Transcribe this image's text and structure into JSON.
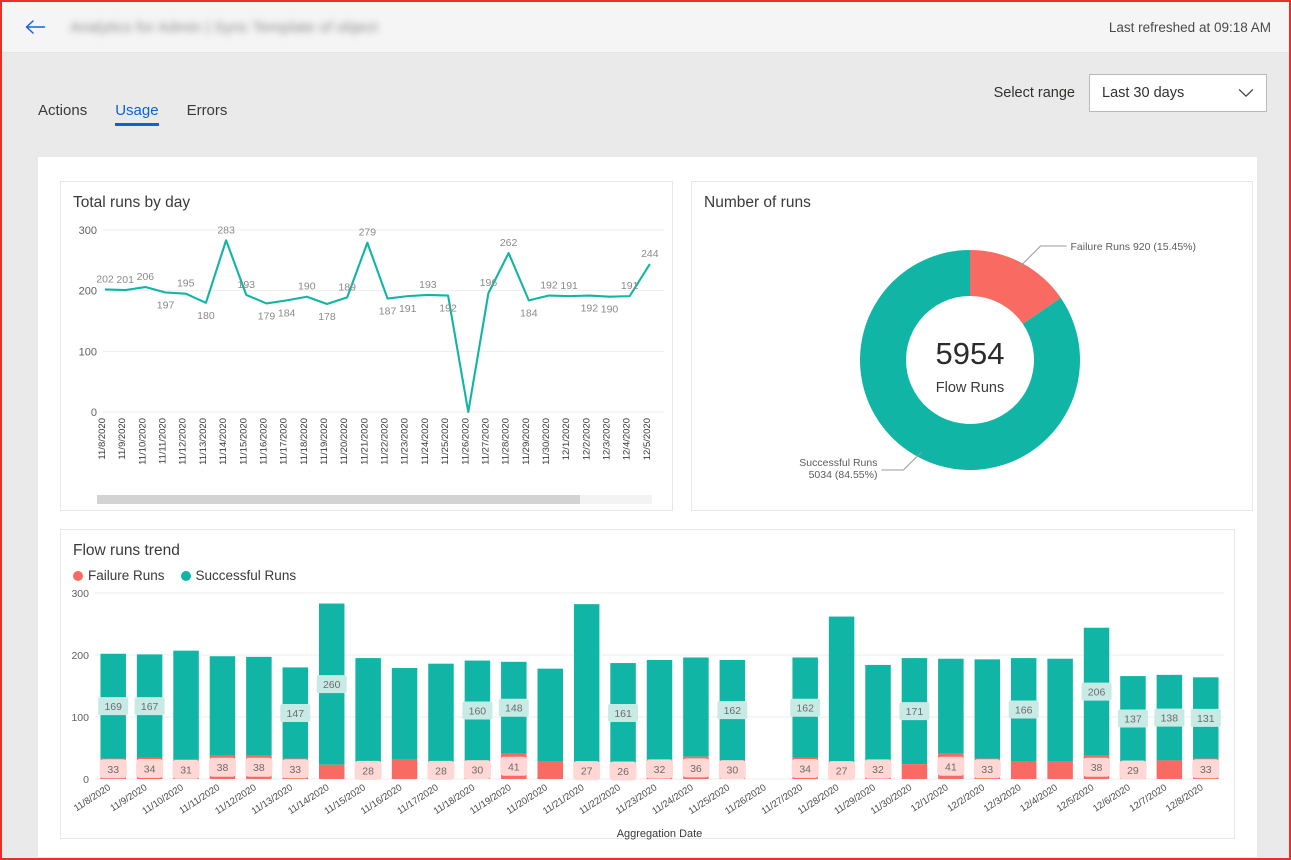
{
  "header": {
    "back_icon": "arrow-left-icon",
    "title": "Analytics for Admin | Sync Template of object",
    "refreshed": "Last refreshed at 09:18 AM"
  },
  "tabs": [
    {
      "label": "Actions",
      "active": false
    },
    {
      "label": "Usage",
      "active": true
    },
    {
      "label": "Errors",
      "active": false
    }
  ],
  "range": {
    "label": "Select range",
    "value": "Last 30 days",
    "caret_icon": "chevron-down-icon",
    "options": [
      "Last 30 days"
    ]
  },
  "colors": {
    "teal": "#10b5a5",
    "red": "#f96a63",
    "accent": "#0f62d0",
    "grid": "#ededed",
    "axis_text": "#6b6b6b"
  },
  "cards": {
    "line_title": "Total runs by day",
    "donut_title": "Number of runs",
    "trend_title": "Flow runs trend"
  },
  "trend_legend": [
    {
      "label": "Failure Runs",
      "color": "#f96a63"
    },
    {
      "label": "Successful Runs",
      "color": "#10b5a5"
    }
  ],
  "chart_data": [
    {
      "type": "line",
      "title": "Total runs by day",
      "xlabel": "",
      "ylabel": "",
      "ylim": [
        0,
        300
      ],
      "yticks": [
        0,
        100,
        200,
        300
      ],
      "grid": true,
      "legend": "none",
      "x": [
        "11/8/2020",
        "11/9/2020",
        "11/10/2020",
        "11/11/2020",
        "11/12/2020",
        "11/13/2020",
        "11/14/2020",
        "11/15/2020",
        "11/16/2020",
        "11/17/2020",
        "11/18/2020",
        "11/19/2020",
        "11/20/2020",
        "11/21/2020",
        "11/22/2020",
        "11/23/2020",
        "11/24/2020",
        "11/25/2020",
        "11/26/2020",
        "11/27/2020",
        "11/28/2020",
        "11/29/2020",
        "11/30/2020",
        "12/1/2020",
        "12/2/2020",
        "12/3/2020",
        "12/4/2020",
        "12/5/2020"
      ],
      "values": [
        202,
        201,
        206,
        197,
        195,
        180,
        283,
        193,
        179,
        184,
        190,
        178,
        189,
        279,
        187,
        191,
        193,
        192,
        0,
        196,
        262,
        184,
        192,
        191,
        192,
        190,
        191,
        244
      ],
      "series": [
        {
          "name": "Total runs",
          "color": "#10b5a5",
          "values": [
            202,
            201,
            206,
            197,
            195,
            180,
            283,
            193,
            179,
            184,
            190,
            178,
            189,
            279,
            187,
            191,
            193,
            192,
            0,
            196,
            262,
            184,
            192,
            191,
            192,
            190,
            191,
            244
          ]
        }
      ],
      "point_labels": [
        "202",
        "201",
        "206",
        "197",
        "195",
        "180",
        "283",
        "193",
        "179",
        "184",
        "190",
        "178",
        "189",
        "279",
        "187",
        "191",
        "193",
        "192",
        "",
        "196",
        "262",
        "184",
        "192",
        "191",
        "192",
        "190",
        "191",
        "244"
      ]
    },
    {
      "type": "pie",
      "title": "Number of runs",
      "donut": true,
      "center_value": "5954",
      "center_label": "Flow Runs",
      "slices": [
        {
          "name": "Failure Runs",
          "value": 920,
          "percent": "15.45%",
          "color": "#f96a63",
          "callout": "Failure Runs 920 (15.45%)"
        },
        {
          "name": "Successful Runs",
          "value": 5034,
          "percent": "84.55%",
          "color": "#10b5a5",
          "callout_line1": "Successful Runs",
          "callout_line2": "5034 (84.55%)"
        }
      ]
    },
    {
      "type": "bar",
      "stacked": true,
      "title": "Flow runs trend",
      "xlabel": "Aggregation Date",
      "ylabel": "",
      "ylim": [
        0,
        300
      ],
      "yticks": [
        0,
        100,
        200,
        300
      ],
      "grid": true,
      "legend": "top-left",
      "categories": [
        "11/8/2020",
        "11/9/2020",
        "11/10/2020",
        "11/11/2020",
        "11/12/2020",
        "11/13/2020",
        "11/14/2020",
        "11/15/2020",
        "11/16/2020",
        "11/17/2020",
        "11/18/2020",
        "11/19/2020",
        "11/20/2020",
        "11/21/2020",
        "11/22/2020",
        "11/23/2020",
        "11/24/2020",
        "11/25/2020",
        "11/26/2020",
        "11/27/2020",
        "11/28/2020",
        "11/29/2020",
        "11/30/2020",
        "12/1/2020",
        "12/2/2020",
        "12/3/2020",
        "12/4/2020",
        "12/5/2020",
        "12/6/2020",
        "12/7/2020",
        "12/8/2020"
      ],
      "series": [
        {
          "name": "Failure Runs",
          "color": "#f96a63",
          "values": [
            33,
            34,
            31,
            38,
            38,
            33,
            23,
            28,
            31,
            28,
            30,
            41,
            29,
            27,
            26,
            32,
            36,
            30,
            0,
            34,
            27,
            32,
            24,
            41,
            33,
            29,
            28,
            38,
            29,
            30,
            33
          ],
          "labels": [
            "33",
            "34",
            "31",
            "38",
            "38",
            "33",
            "",
            "28",
            "",
            "28",
            "30",
            "41",
            "",
            "27",
            "26",
            "32",
            "36",
            "30",
            "",
            "34",
            "27",
            "32",
            "",
            "41",
            "33",
            "",
            "",
            "38",
            "29",
            "",
            "33"
          ]
        },
        {
          "name": "Successful Runs",
          "color": "#10b5a5",
          "values": [
            169,
            167,
            176,
            160,
            159,
            147,
            260,
            167,
            148,
            158,
            161,
            148,
            149,
            255,
            161,
            160,
            160,
            162,
            0,
            162,
            235,
            152,
            171,
            153,
            160,
            166,
            166,
            206,
            137,
            138,
            131
          ],
          "labels": [
            "169",
            "167",
            "",
            "",
            "",
            "147",
            "260",
            "",
            "",
            "",
            "160",
            "148",
            "",
            "",
            "161",
            "",
            "",
            "162",
            "",
            "162",
            "",
            "",
            "171",
            "",
            "",
            "166",
            "",
            "206",
            "137",
            "138",
            "131"
          ]
        }
      ],
      "totals": [
        202,
        201,
        207,
        198,
        197,
        180,
        283,
        195,
        179,
        186,
        191,
        189,
        178,
        282,
        187,
        192,
        196,
        192,
        0,
        196,
        262,
        184,
        195,
        194,
        193,
        195,
        194,
        244,
        166,
        168,
        164
      ]
    }
  ]
}
